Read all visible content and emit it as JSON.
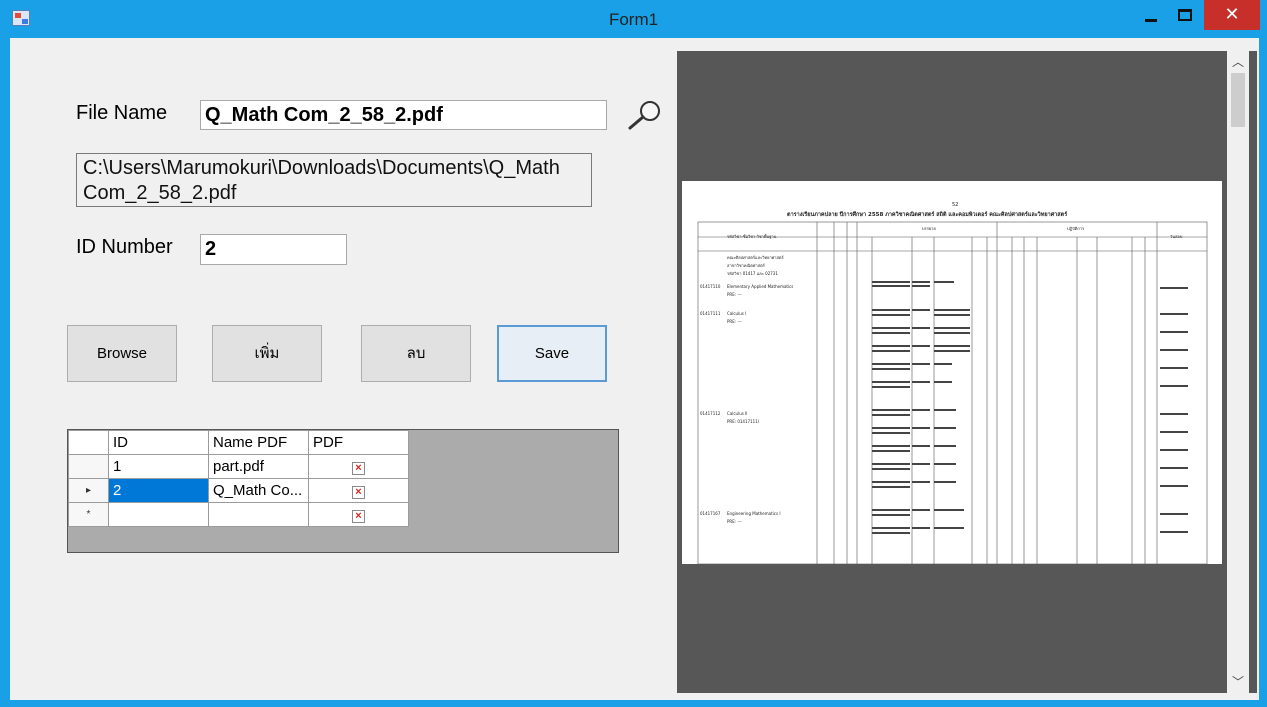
{
  "window": {
    "title": "Form1",
    "minimize": "",
    "maximize": "",
    "close": "✕"
  },
  "form": {
    "file_name_label": "File Name",
    "file_name_value": "Q_Math  Com_2_58_2.pdf",
    "path_text": "C:\\Users\\Marumokuri\\Downloads\\Documents\\Q_Math Com_2_58_2.pdf",
    "id_label": "ID Number",
    "id_value": "2"
  },
  "buttons": {
    "browse": "Browse",
    "add": "เพิ่ม",
    "delete": "ลบ",
    "save": "Save"
  },
  "grid": {
    "headers": [
      "ID",
      "Name PDF",
      "PDF"
    ],
    "rows": [
      {
        "marker": "",
        "id": "1",
        "name": "part.pdf",
        "pdf": "×"
      },
      {
        "marker": "▸",
        "id": "2",
        "name": "Q_Math Co...",
        "pdf": "×"
      },
      {
        "marker": "*",
        "id": "",
        "name": "",
        "pdf": "×"
      }
    ]
  },
  "pdf_preview": {
    "page_number": "52",
    "heading": "ตารางเรียนภาคปลาย ปีการศึกษา 2558 ภาควิชาคณิตศาสตร์ สถิติ และคอมพิวเตอร์ คณะศิลปศาสตร์และวิทยาศาสตร์",
    "col_course": "รหัสวิชา-ชื่อวิชา-วิชาพื้นฐาน",
    "col_lecture": "บรรยาย",
    "col_lab": "ปฏิบัติการ",
    "col_exam": "วันสอบ",
    "faculty_line1": "คณะศิลปศาสตร์และวิทยาศาสตร์",
    "faculty_line2": "สาขาวิชาคณิตศาสตร์",
    "faculty_line3": "รหัสวิชา 01417 และ 02731",
    "courses": [
      {
        "code": "01417110",
        "name": "Elementary Applied Mathematics",
        "pre": "PRE: ---"
      },
      {
        "code": "01417111",
        "name": "Calculus I",
        "pre": "PRE: ---"
      },
      {
        "code": "01417112",
        "name": "Calculus II",
        "pre": "PRE: 01417111/"
      },
      {
        "code": "01417167",
        "name": "Engineering Mathematics I",
        "pre": "PRE: ---"
      }
    ]
  },
  "scrollbar": {
    "up": "︿",
    "down": "﹀"
  }
}
